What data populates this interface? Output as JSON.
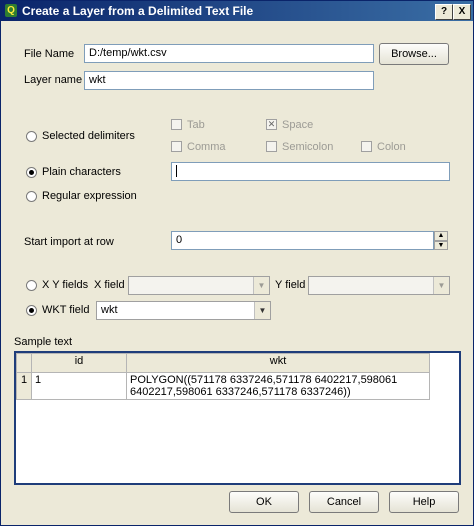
{
  "window": {
    "title": "Create a Layer from a Delimited Text File",
    "help_glyph": "?",
    "close_glyph": "X"
  },
  "file": {
    "label": "File Name",
    "value": "D:/temp/wkt.csv",
    "browse_label": "Browse..."
  },
  "layer": {
    "label": "Layer name",
    "value": "wkt"
  },
  "delimiters": {
    "selected_label": "Selected delimiters",
    "plain_label": "Plain characters",
    "plain_value": "|",
    "regex_label": "Regular expression",
    "selected_mode": "plain",
    "checkboxes": [
      {
        "label": "Tab",
        "checked": false
      },
      {
        "label": "Space",
        "checked": true
      },
      {
        "label": "Comma",
        "checked": false
      },
      {
        "label": "Semicolon",
        "checked": false
      },
      {
        "label": "Colon",
        "checked": false
      }
    ]
  },
  "start_row": {
    "label": "Start import at row",
    "value": "0"
  },
  "geometry": {
    "xy_label": "X Y fields",
    "x_field_label": "X field",
    "y_field_label": "Y field",
    "wkt_label": "WKT field",
    "wkt_value": "wkt",
    "selected": "wkt"
  },
  "sample": {
    "label": "Sample text",
    "columns": [
      "id",
      "wkt"
    ],
    "rows": [
      {
        "row_number": "1",
        "id": "1",
        "wkt": "POLYGON((571178 6337246,571178 6402217,598061 6402217,598061 6337246,571178 6337246))"
      }
    ]
  },
  "buttons": {
    "ok": "OK",
    "cancel": "Cancel",
    "help": "Help"
  }
}
